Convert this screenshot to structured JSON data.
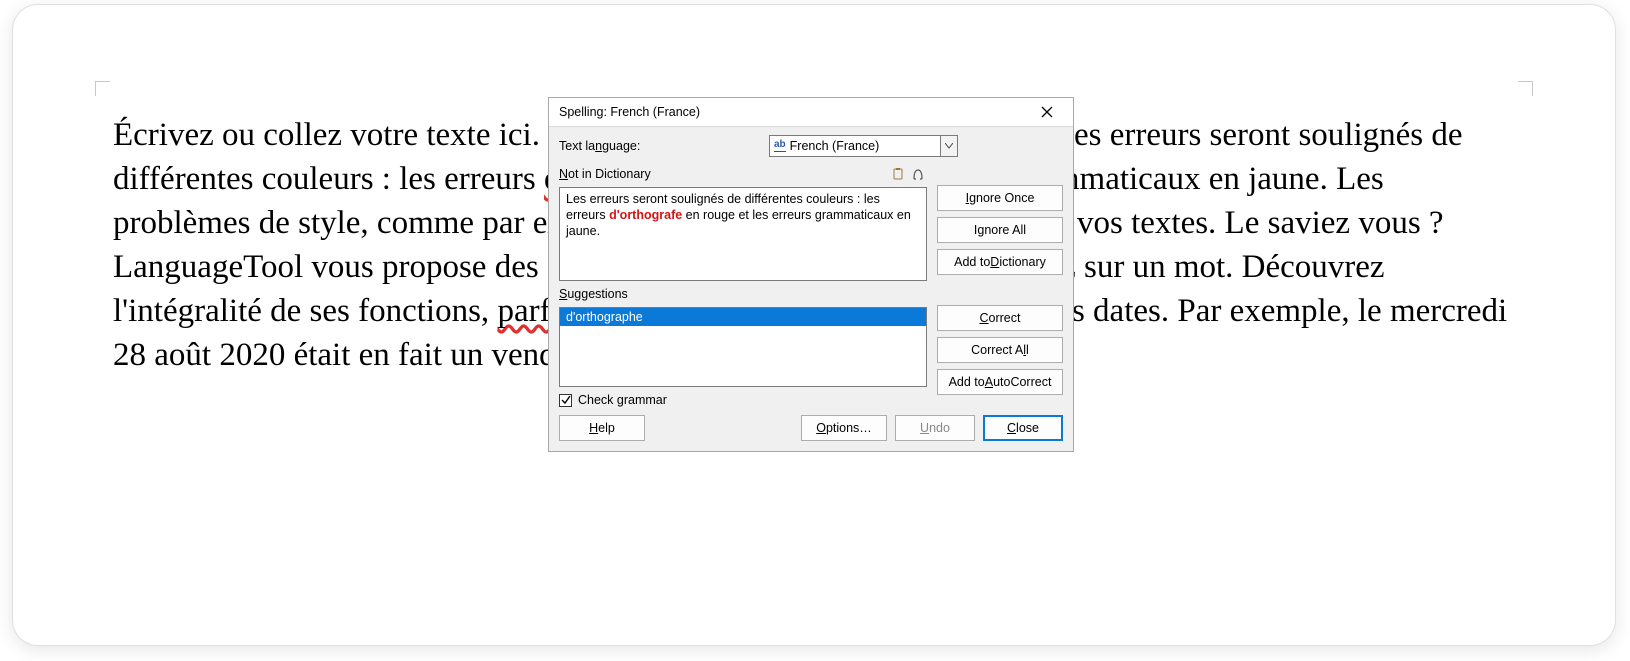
{
  "document": {
    "seg1": "Écrivez ou collez votre texte ici. La vérification s'effectue en continue. Les erreurs seront soulignés de différentes couleurs : les erreurs ",
    "err1": "d'orthografe",
    "seg2": " en rouge et les erreurs grammaticaux en jaune. Les problèmes de style, comme par exemple ceci, sera souligné en bleu dans vos textes. Le saviez vous ? LanguageTool vous propose des synonymes lorsque vous double-cliquez sur un mot. Découvrez l'intégralité de ses fonctions, ",
    "err2": "parfoi",
    "seg3": " inattendues, tel que la vérification des dates. Par exemple, le mercredi 28 août 2020 était en fait un vendredi !"
  },
  "dialog": {
    "title": "Spelling: French (France)",
    "text_language_label": "Text la",
    "text_language_label_u": "n",
    "text_language_label_after": "guage:",
    "language_value": "French (France)",
    "not_in_dict_label_u": "N",
    "not_in_dict_label_after": "ot in Dictionary",
    "nid_pre": "Les erreurs seront soulignés de différentes couleurs : les erreurs ",
    "nid_err": "d'orthografe",
    "nid_post": " en rouge et les erreurs grammaticaux en jaune.",
    "suggestions_label_u": "S",
    "suggestions_label_after": "uggestions",
    "suggestion_item": "d'orthographe",
    "check_grammar_label": "Check grammar",
    "buttons": {
      "ignore_once_u": "I",
      "ignore_once_after": "gnore Once",
      "ignore_all_pre": "I",
      "ignore_all_u": "g",
      "ignore_all_after": "nore All",
      "add_to_dict_pre": "Add to ",
      "add_to_dict_u": "D",
      "add_to_dict_after": "ictionary",
      "correct_u": "C",
      "correct_after": "orrect",
      "correct_all_pre": "Correct A",
      "correct_all_u": "l",
      "correct_all_after": "l",
      "autocorrect_pre": "Add to ",
      "autocorrect_u": "A",
      "autocorrect_after": "utoCorrect",
      "help_u": "H",
      "help_after": "elp",
      "options_u": "O",
      "options_after": "ptions…",
      "undo_u": "U",
      "undo_after": "ndo",
      "close_u": "C",
      "close_after": "lose"
    }
  }
}
